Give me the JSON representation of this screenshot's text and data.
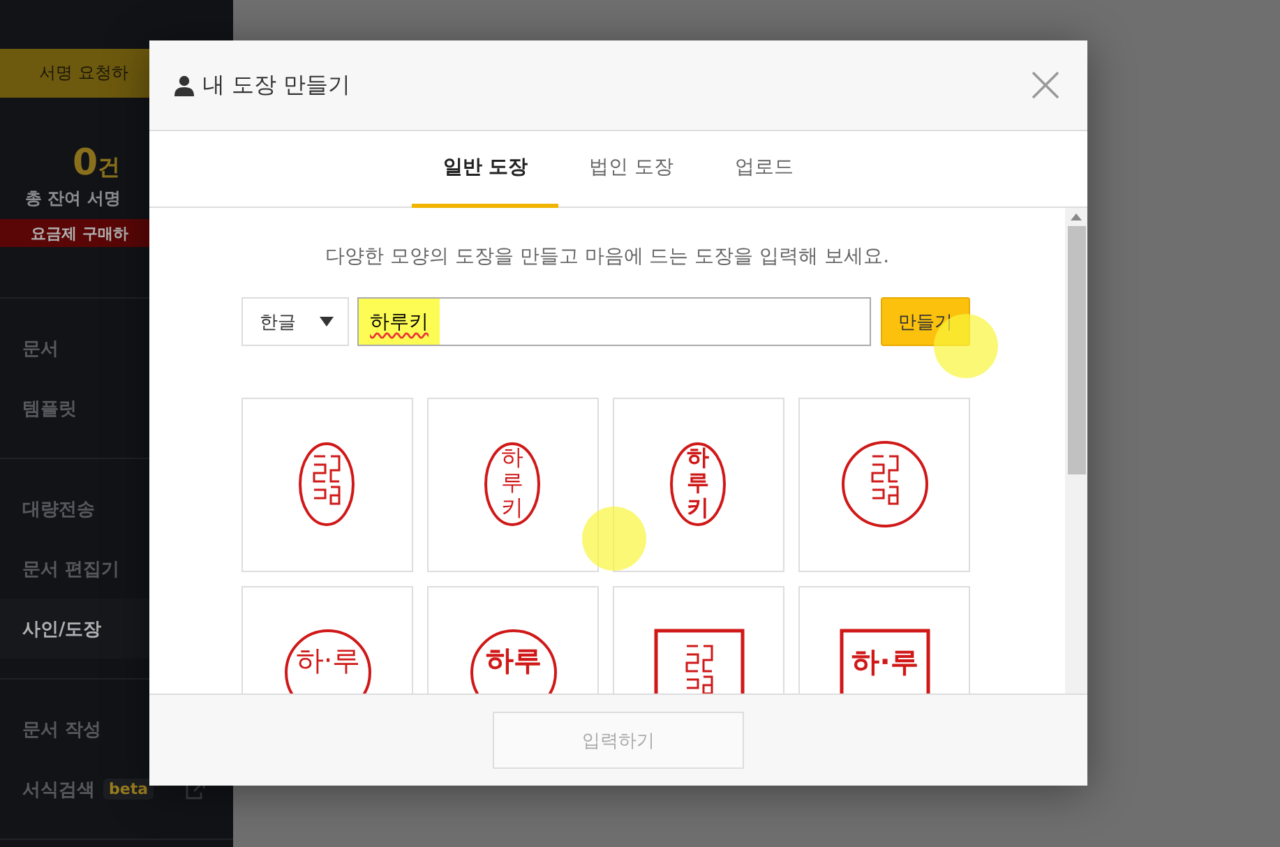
{
  "sidebar": {
    "request_button": "서명 요청하",
    "count": {
      "number": "0",
      "unit": "건"
    },
    "remaining_label": "총 잔여 서명",
    "purchase_button": "요금제 구매하",
    "groups": [
      [
        {
          "label": "문서",
          "selected": false
        },
        {
          "label": "템플릿",
          "selected": false
        }
      ],
      [
        {
          "label": "대량전송",
          "selected": false
        },
        {
          "label": "문서 편집기",
          "selected": false
        },
        {
          "label": "사인/도장",
          "selected": true
        }
      ],
      [
        {
          "label": "문서 작성",
          "selected": false
        },
        {
          "label": "서식검색",
          "selected": false,
          "badge": "beta",
          "external": true
        }
      ]
    ]
  },
  "dialog": {
    "title": "내 도장 만들기",
    "tabs": [
      {
        "label": "일반 도장",
        "selected": true
      },
      {
        "label": "법인 도장",
        "selected": false
      },
      {
        "label": "업로드",
        "selected": false
      }
    ],
    "description": "다양한 모양의 도장을 만들고 마음에 드는 도장을 입력해 보세요.",
    "language_select": {
      "value": "한글"
    },
    "name_field": {
      "value": "하루키"
    },
    "make_button": "만들기",
    "stamps": [
      {
        "kind": "oval-seal"
      },
      {
        "kind": "oval",
        "text": "하루키",
        "bold": false
      },
      {
        "kind": "oval",
        "text": "하루키",
        "bold": true
      },
      {
        "kind": "circle-seal"
      },
      {
        "kind": "circle",
        "text": "하·루",
        "bold": false
      },
      {
        "kind": "circle",
        "text": "하루",
        "bold": true
      },
      {
        "kind": "square-seal"
      },
      {
        "kind": "square",
        "text": "하·루",
        "bold": true
      }
    ],
    "submit_button": {
      "label": "입력하기",
      "disabled": true
    }
  }
}
